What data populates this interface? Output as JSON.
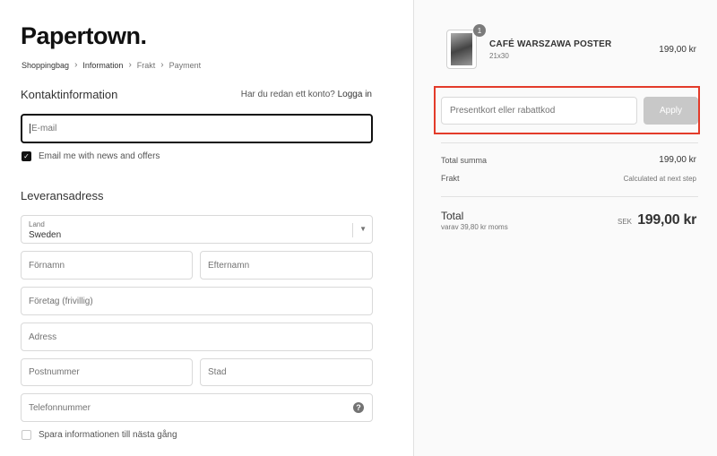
{
  "brand": {
    "logo": "Papertown."
  },
  "breadcrumb": [
    {
      "label": "Shoppingbag",
      "muted": false
    },
    {
      "label": "Information",
      "muted": false
    },
    {
      "label": "Frakt",
      "muted": true
    },
    {
      "label": "Payment",
      "muted": true
    }
  ],
  "contact": {
    "title": "Kontaktinformation",
    "login_prompt": "Har du redan ett konto?",
    "login_link": "Logga in",
    "email_placeholder": "E-mail",
    "newsletter_label": "Email me with news and offers",
    "newsletter_checked": true
  },
  "shipping": {
    "title": "Leveransadress",
    "country_label": "Land",
    "country_value": "Sweden",
    "first_name": "Förnamn",
    "last_name": "Efternamn",
    "company": "Företag (frivillig)",
    "address": "Adress",
    "postal_code": "Postnummer",
    "city": "Stad",
    "phone": "Telefonnummer",
    "save_info_label": "Spara informationen till nästa gång",
    "save_info_checked": false
  },
  "summary": {
    "product": {
      "quantity": "1",
      "name": "CAFÉ WARSZAWA POSTER",
      "variant": "21x30",
      "price": "199,00 kr"
    },
    "discount": {
      "placeholder": "Presentkort eller rabattkod",
      "apply_label": "Apply"
    },
    "subtotal_label": "Total summa",
    "subtotal_value": "199,00 kr",
    "shipping_label": "Frakt",
    "shipping_value": "Calculated at next step",
    "total_label": "Total",
    "tax_note": "varav 39,80 kr moms",
    "currency": "SEK",
    "total_value": "199,00 kr"
  },
  "colors": {
    "highlight_border": "#e33b2a",
    "apply_button": "#c8c8c8",
    "focus_border": "#111111"
  }
}
